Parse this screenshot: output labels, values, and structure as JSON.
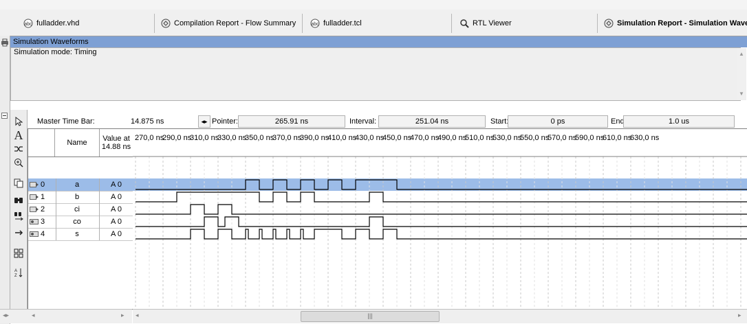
{
  "tabs": [
    {
      "label": "fulladder.vhd",
      "icon": "vhdl-file-icon",
      "active": false
    },
    {
      "label": "Compilation Report - Flow Summary",
      "icon": "report-icon",
      "active": false
    },
    {
      "label": "fulladder.tcl",
      "icon": "tcl-file-icon",
      "active": false
    },
    {
      "label": "RTL Viewer",
      "icon": "rtl-viewer-icon",
      "active": false
    },
    {
      "label": "Simulation Report - Simulation Wave...",
      "icon": "report-icon",
      "active": true
    }
  ],
  "section": {
    "title": "Simulation Waveforms",
    "mode": "Simulation mode: Timing"
  },
  "timebar": {
    "master_label": "Master Time Bar:",
    "master_value": "14.875 ns",
    "pointer_label": "Pointer:",
    "pointer_value": "265.91 ns",
    "interval_label": "Interval:",
    "interval_value": "251.04 ns",
    "start_label": "Start:",
    "start_value": "0 ps",
    "end_label": "End:",
    "end_value": "1.0 us"
  },
  "grid": {
    "name_header": "Name",
    "value_header_line1": "Value at",
    "value_header_line2": "14.88 ns",
    "rows": [
      {
        "index": "0",
        "name": "a",
        "value": "A 0",
        "kind": "input"
      },
      {
        "index": "1",
        "name": "b",
        "value": "A 0",
        "kind": "input"
      },
      {
        "index": "2",
        "name": "ci",
        "value": "A 0",
        "kind": "input"
      },
      {
        "index": "3",
        "name": "co",
        "value": "A 0",
        "kind": "output"
      },
      {
        "index": "4",
        "name": "s",
        "value": "A 0",
        "kind": "output"
      }
    ]
  },
  "time_axis": [
    "270,0 ns",
    "290,0 ns",
    "310,0 ns",
    "330,0 ns",
    "350,0 ns",
    "370,0 ns",
    "390,0 ns",
    "410,0 ns",
    "430,0 ns",
    "450,0 ns",
    "470,0 ns",
    "490,0 ns",
    "510,0 ns",
    "530,0 ns",
    "550,0 ns",
    "570,0 ns",
    "590,0 ns",
    "610,0 ns",
    "630,0 ns"
  ],
  "waveforms": {
    "a": [
      [
        270,
        0
      ],
      [
        350,
        1
      ],
      [
        360,
        0
      ],
      [
        370,
        1
      ],
      [
        380,
        0
      ],
      [
        390,
        1
      ],
      [
        400,
        0
      ],
      [
        410,
        1
      ],
      [
        420,
        0
      ],
      [
        430,
        1
      ],
      [
        460,
        0
      ]
    ],
    "b": [
      [
        270,
        0
      ],
      [
        300,
        1
      ],
      [
        360,
        0
      ],
      [
        370,
        1
      ],
      [
        380,
        0
      ],
      [
        390,
        1
      ],
      [
        400,
        0
      ],
      [
        440,
        1
      ],
      [
        450,
        0
      ]
    ],
    "ci": [
      [
        270,
        0
      ],
      [
        310,
        1
      ],
      [
        320,
        0
      ],
      [
        330,
        1
      ],
      [
        340,
        0
      ]
    ],
    "co": [
      [
        270,
        0
      ],
      [
        320,
        1
      ],
      [
        330,
        0
      ],
      [
        335,
        1
      ],
      [
        345,
        0
      ],
      [
        440,
        1
      ],
      [
        450,
        0
      ]
    ],
    "s": [
      [
        270,
        0
      ],
      [
        310,
        1
      ],
      [
        320,
        0
      ],
      [
        330,
        1
      ],
      [
        340,
        0
      ],
      [
        350,
        1
      ],
      [
        352,
        0
      ],
      [
        360,
        1
      ],
      [
        362,
        0
      ],
      [
        370,
        1
      ],
      [
        372,
        0
      ],
      [
        380,
        1
      ],
      [
        382,
        0
      ],
      [
        390,
        1
      ],
      [
        392,
        0
      ],
      [
        400,
        1
      ],
      [
        420,
        0
      ],
      [
        430,
        1
      ],
      [
        440,
        0
      ],
      [
        450,
        1
      ],
      [
        460,
        0
      ]
    ]
  },
  "colors": {
    "header_blue": "#7ea0d4",
    "selected_row": "#9cbce8"
  }
}
